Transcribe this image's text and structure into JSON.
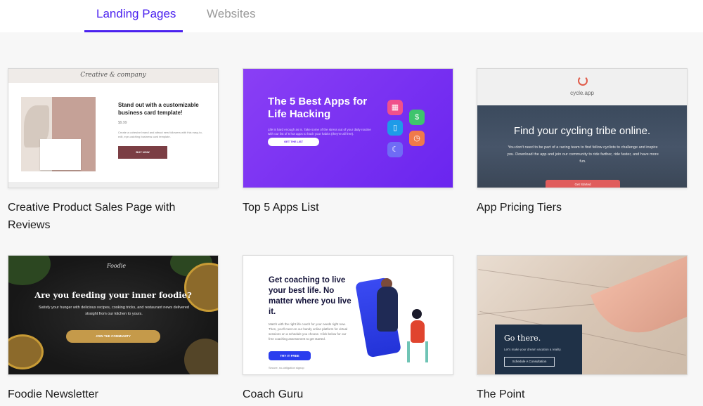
{
  "tabs": [
    {
      "label": "Landing Pages",
      "active": true
    },
    {
      "label": "Websites",
      "active": false
    }
  ],
  "accent_color": "#4a21ef",
  "templates": [
    {
      "title": "Creative Product Sales Page with Reviews",
      "preview": {
        "logo": "Creative & company",
        "heading": "Stand out with a customizable business card template!",
        "price": "$9.99",
        "description": "Create a cohesive brand and attract new followers with this easy-to-edit, eye-catching business card template.",
        "button": "BUY NOW"
      }
    },
    {
      "title": "Top 5 Apps List",
      "preview": {
        "heading": "The 5 Best Apps for Life Hacking",
        "description": "Life is hard enough as is. Take some of the stress out of your daily routine with our list of 5 hot apps to hack your habits (they're all free).",
        "button": "GET THE LIST",
        "app_icons": [
          "calendar-icon",
          "dollar-icon",
          "phone-icon",
          "timer-icon",
          "moon-icon"
        ]
      }
    },
    {
      "title": "App Pricing Tiers",
      "preview": {
        "logo": "cycle.app",
        "heading": "Find your cycling tribe online.",
        "description": "You don't need to be part of a racing team to find fellow cyclists to challenge and inspire you. Download the app and join our community to ride farther, ride faster, and have more fun.",
        "button": "Get Started"
      }
    },
    {
      "title": "Foodie Newsletter",
      "preview": {
        "logo": "Foodie",
        "heading": "Are you feeding your inner foodie?",
        "description": "Satisfy your hunger with delicious recipes, cooking tricks, and restaurant news delivered straight from our kitchen to yours.",
        "button": "JOIN THE COMMUNITY"
      }
    },
    {
      "title": "Coach Guru",
      "preview": {
        "heading": "Get coaching to live your best life. No matter where you live it.",
        "description": "Match with the right life coach for your needs right now. Then, you'll meet on our handy online platform for virtual sessions on a schedule you choose. Click below for our free coaching assessment to get started.",
        "button": "TRY IT FREE",
        "note": "Secure, no-obligation signup"
      }
    },
    {
      "title": "The Point",
      "preview": {
        "heading": "Go there.",
        "description": "Let's make your dream vacation a reality.",
        "button": "Schedule A Consultation"
      }
    }
  ]
}
